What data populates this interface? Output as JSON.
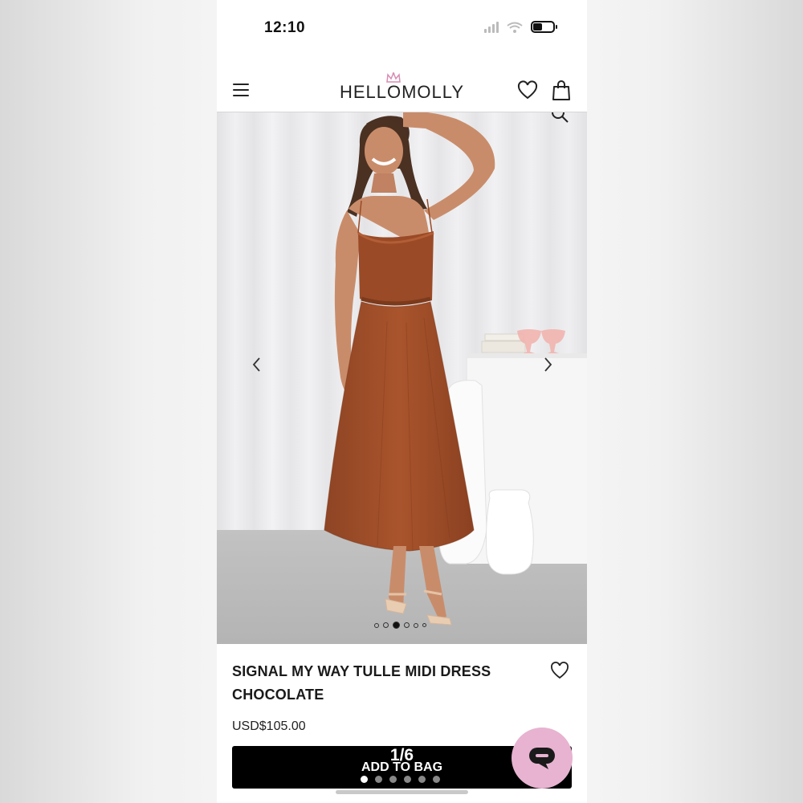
{
  "status_bar": {
    "time": "12:10"
  },
  "header": {
    "logo": "HELLOMOLLY",
    "icons": {
      "menu": "hamburger-menu-icon",
      "wishlist": "heart-icon",
      "bag": "shopping-bag-icon"
    }
  },
  "gallery": {
    "image_description": "product-photo",
    "dots": 6,
    "active_dot": 3
  },
  "product": {
    "title": "SIGNAL MY WAY TULLE MIDI DRESS CHOCOLATE",
    "price": "USD$105.00"
  },
  "cta": {
    "counter": "1/6",
    "label": "ADD TO BAG",
    "dots": 6,
    "active_dot": 0
  },
  "colors": {
    "accent_chat": "#e7b3d0",
    "dress": "#a3512b",
    "button": "#000000"
  }
}
